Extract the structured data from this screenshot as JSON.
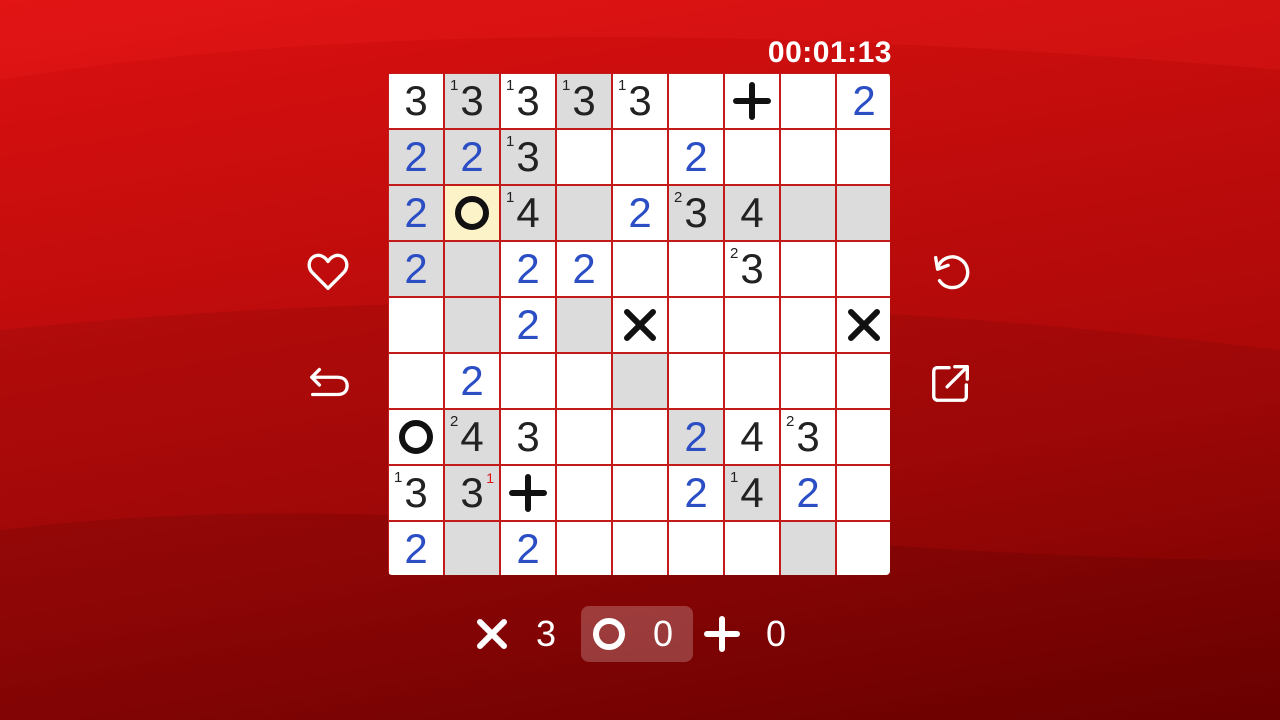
{
  "timer": "00:01:13",
  "grid": {
    "size": 9,
    "cells": [
      [
        {
          "n": "3"
        },
        {
          "n": "3",
          "sup": "1",
          "shaded": true
        },
        {
          "n": "3",
          "sup": "1"
        },
        {
          "n": "3",
          "sup": "1",
          "shaded": true
        },
        {
          "n": "3",
          "sup": "1"
        },
        {},
        {
          "mark": "plus"
        },
        {},
        {
          "n": "2",
          "blue": true
        }
      ],
      [
        {
          "n": "2",
          "blue": true,
          "shaded": true
        },
        {
          "n": "2",
          "blue": true,
          "shaded": true
        },
        {
          "n": "3",
          "sup": "1",
          "shaded": true
        },
        {},
        {},
        {
          "n": "2",
          "blue": true
        },
        {},
        {},
        {}
      ],
      [
        {
          "n": "2",
          "blue": true,
          "shaded": true
        },
        {
          "mark": "circle",
          "selected": true
        },
        {
          "n": "4",
          "sup": "1",
          "shaded": true
        },
        {
          "shaded": true
        },
        {
          "n": "2",
          "blue": true
        },
        {
          "n": "3",
          "sup": "2",
          "shaded": true
        },
        {
          "n": "4",
          "shaded": true
        },
        {
          "shaded": true
        },
        {
          "shaded": true
        }
      ],
      [
        {
          "n": "2",
          "blue": true,
          "shaded": true
        },
        {
          "shaded": true
        },
        {
          "n": "2",
          "blue": true
        },
        {
          "n": "2",
          "blue": true
        },
        {},
        {},
        {
          "n": "3",
          "sup": "2"
        },
        {},
        {}
      ],
      [
        {},
        {
          "shaded": true
        },
        {
          "n": "2",
          "blue": true
        },
        {
          "shaded": true
        },
        {
          "mark": "cross"
        },
        {},
        {},
        {},
        {
          "mark": "cross"
        }
      ],
      [
        {},
        {
          "n": "2",
          "blue": true
        },
        {},
        {},
        {
          "shaded": true
        },
        {},
        {},
        {},
        {}
      ],
      [
        {
          "mark": "circle"
        },
        {
          "n": "4",
          "sup": "2",
          "shaded": true
        },
        {
          "n": "3"
        },
        {},
        {},
        {
          "n": "2",
          "blue": true,
          "shaded": true
        },
        {
          "n": "4"
        },
        {
          "n": "3",
          "sup": "2"
        },
        {}
      ],
      [
        {
          "n": "3",
          "sup": "1"
        },
        {
          "n": "3",
          "supRed": "1",
          "shaded": true
        },
        {
          "mark": "plus"
        },
        {},
        {},
        {
          "n": "2",
          "blue": true
        },
        {
          "n": "4",
          "sup": "1",
          "shaded": true
        },
        {
          "n": "2",
          "blue": true
        },
        {}
      ],
      [
        {
          "n": "2",
          "blue": true
        },
        {
          "shaded": true
        },
        {
          "n": "2",
          "blue": true
        },
        {},
        {},
        {},
        {},
        {
          "shaded": true
        },
        {}
      ]
    ]
  },
  "side_buttons": {
    "left": [
      {
        "icon": "heart-icon"
      },
      {
        "icon": "undo-arrow-icon"
      }
    ],
    "right": [
      {
        "icon": "restart-icon"
      },
      {
        "icon": "share-external-icon"
      }
    ]
  },
  "tools": [
    {
      "icon": "cross-icon",
      "count": "3",
      "active": false
    },
    {
      "icon": "circle-icon",
      "count": "0",
      "active": true
    },
    {
      "icon": "plus-icon",
      "count": "0",
      "active": false
    }
  ],
  "colors": {
    "background": "#c00c0c",
    "blue_number": "#2b4ec4",
    "grid_line": "#c31a1a",
    "shaded_cell": "#dcdcdc",
    "selected_cell": "#fdf3c8"
  }
}
